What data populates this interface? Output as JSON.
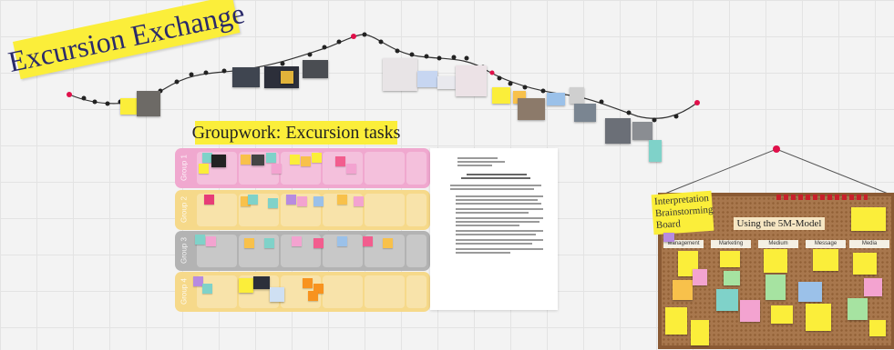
{
  "titles": {
    "exchange": "Excursion Exchange",
    "groupwork": "Groupwork: Excursion tasks",
    "board_label": "Interpretation Brainstorming Board",
    "board_title": "Using the 5M-Model"
  },
  "groups": [
    {
      "label": "Group 1",
      "color": "#f0a8cf"
    },
    {
      "label": "Group 2",
      "color": "#f6d98a"
    },
    {
      "label": "Group 3",
      "color": "#b3b3b3"
    },
    {
      "label": "Group 4",
      "color": "#f6d98a"
    }
  ],
  "board_columns": [
    "Management",
    "Marketing",
    "Medium",
    "Message",
    "Media"
  ],
  "colors": {
    "yellow_highlight": "#fbee3a",
    "string": "#333333",
    "pin_red": "#e0104a",
    "cork": "#a8774d"
  }
}
